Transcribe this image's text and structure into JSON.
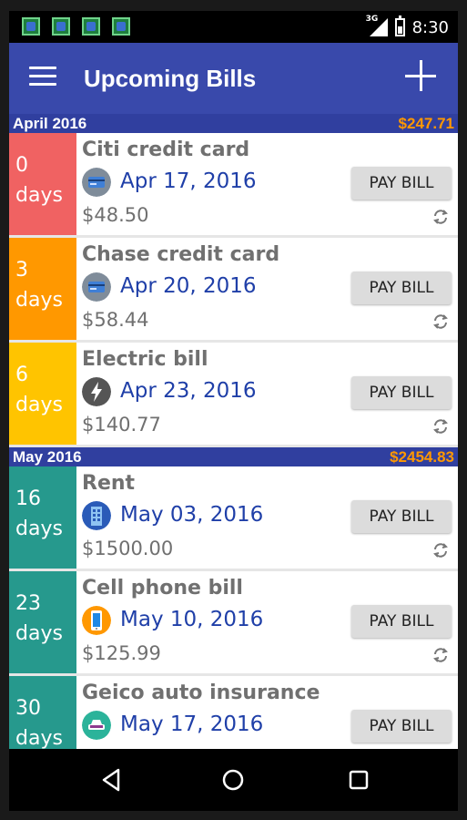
{
  "status_bar": {
    "notification_icons": [
      "check-notification-icon",
      "check-notification-icon",
      "check-notification-icon",
      "check-notification-icon"
    ],
    "network_label": "3G",
    "time": "8:30"
  },
  "app_bar": {
    "title": "Upcoming Bills"
  },
  "months": [
    {
      "name": "April 2016",
      "total": "$247.71",
      "bills": [
        {
          "days_num": "0",
          "days_label": "days",
          "color": "#f06262",
          "name": "Citi credit card",
          "icon": "credit-card-icon",
          "date": "Apr 17, 2016",
          "amount": "$48.50",
          "pay_label": "PAY BILL"
        },
        {
          "days_num": "3",
          "days_label": "days",
          "color": "#ff9800",
          "name": "Chase credit card",
          "icon": "credit-card-icon",
          "date": "Apr 20, 2016",
          "amount": "$58.44",
          "pay_label": "PAY BILL"
        },
        {
          "days_num": "6",
          "days_label": "days",
          "color": "#ffc400",
          "name": "Electric bill",
          "icon": "lightning-icon",
          "date": "Apr 23, 2016",
          "amount": "$140.77",
          "pay_label": "PAY BILL"
        }
      ]
    },
    {
      "name": "May 2016",
      "total": "$2454.83",
      "bills": [
        {
          "days_num": "16",
          "days_label": "days",
          "color": "#26998d",
          "name": "Rent",
          "icon": "building-icon",
          "date": "May 03, 2016",
          "amount": "$1500.00",
          "pay_label": "PAY BILL"
        },
        {
          "days_num": "23",
          "days_label": "days",
          "color": "#26998d",
          "name": "Cell phone bill",
          "icon": "phone-icon",
          "date": "May 10, 2016",
          "amount": "$125.99",
          "pay_label": "PAY BILL"
        },
        {
          "days_num": "30",
          "days_label": "days",
          "color": "#26998d",
          "name": "Geico auto insurance",
          "icon": "car-icon",
          "date": "May 17, 2016",
          "amount": "",
          "pay_label": "PAY BILL"
        }
      ]
    }
  ],
  "colors": {
    "app_bar": "#3949ab",
    "month_header": "#303f9f",
    "month_total": "#ff9800",
    "date_text": "#1f3fa8"
  }
}
